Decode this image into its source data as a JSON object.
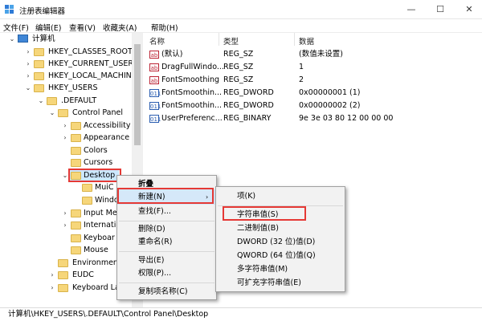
{
  "window": {
    "title": "注册表编辑器",
    "icon": "registry-icon",
    "minimize": "—",
    "maximize": "☐",
    "close": "✕"
  },
  "menu": [
    "文件(F)",
    "编辑(E)",
    "查看(V)",
    "收藏夹(A)",
    "帮助(H)"
  ],
  "tree": {
    "computer": "计算机",
    "hkcr": "HKEY_CLASSES_ROOT",
    "hkcu": "HKEY_CURRENT_USER",
    "hklm": "HKEY_LOCAL_MACHINE",
    "hku": "HKEY_USERS",
    "default": ".DEFAULT",
    "control_panel": "Control Panel",
    "accessibility": "Accessibility",
    "appearance": "Appearance",
    "colors": "Colors",
    "cursors": "Cursors",
    "desktop": "Desktop",
    "muic": "MuiC",
    "windo": "Windo",
    "input_me": "Input Me",
    "internatio": "Internatio",
    "keyboard": "Keyboar",
    "mouse": "Mouse",
    "environment": "Environment",
    "eudc": "EUDC",
    "keyboard_la": "Keyboard La"
  },
  "list": {
    "headers": {
      "name": "名称",
      "type": "类型",
      "data": "数据"
    },
    "rows": [
      {
        "icon": "ab",
        "name": "(默认)",
        "type": "REG_SZ",
        "data": "(数值未设置)"
      },
      {
        "icon": "ab",
        "name": "DragFullWindo...",
        "type": "REG_SZ",
        "data": "1"
      },
      {
        "icon": "ab",
        "name": "FontSmoothing",
        "type": "REG_SZ",
        "data": "2"
      },
      {
        "icon": "011",
        "name": "FontSmoothin...",
        "type": "REG_DWORD",
        "data": "0x00000001 (1)"
      },
      {
        "icon": "011",
        "name": "FontSmoothin...",
        "type": "REG_DWORD",
        "data": "0x00000002 (2)"
      },
      {
        "icon": "011",
        "name": "UserPreferenc...",
        "type": "REG_BINARY",
        "data": "9e 3e 03 80 12 00 00 00"
      }
    ]
  },
  "context_menu": {
    "collapse": "折叠",
    "new": "新建(N)",
    "find": "查找(F)...",
    "delete": "删除(D)",
    "rename": "重命名(R)",
    "export": "导出(E)",
    "permissions": "权限(P)...",
    "copy_key_name": "复制项名称(C)",
    "submenu_arrow": "›"
  },
  "submenu": {
    "key": "项(K)",
    "string": "字符串值(S)",
    "binary": "二进制值(B)",
    "dword": "DWORD (32 位)值(D)",
    "qword": "QWORD (64 位)值(Q)",
    "multi_string": "多字符串值(M)",
    "expandable_string": "可扩充字符串值(E)"
  },
  "status": "计算机\\HKEY_USERS\\.DEFAULT\\Control Panel\\Desktop",
  "colors": {
    "highlight": "#cce8ff",
    "annotation": "#e53935",
    "folder": "#f6d67a"
  }
}
